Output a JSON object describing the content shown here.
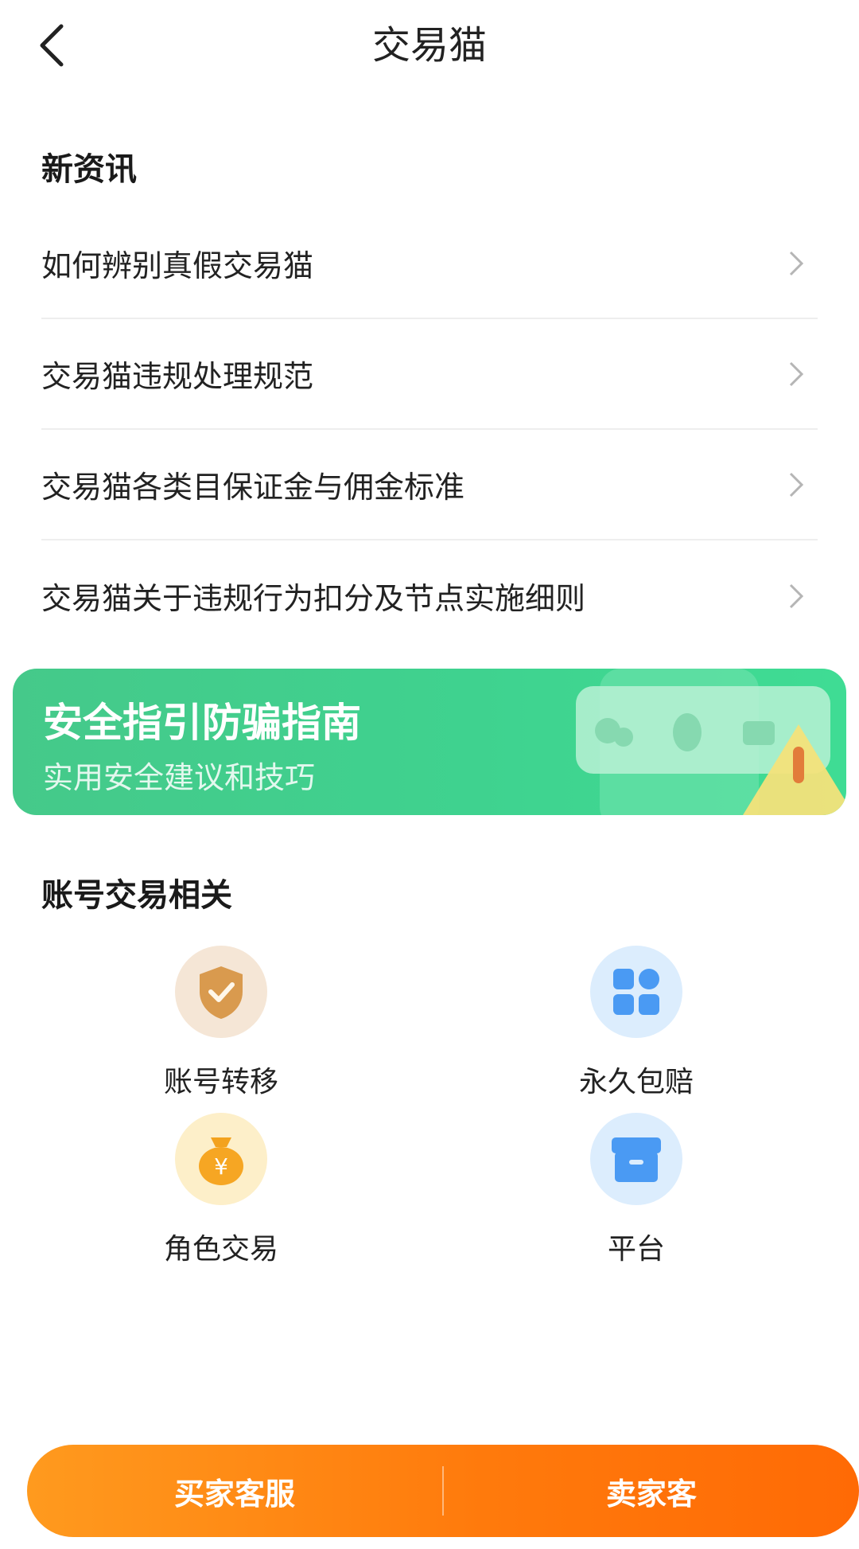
{
  "header": {
    "title": "交易猫",
    "back_icon": "chevron-left-icon"
  },
  "news": {
    "title": "新资讯",
    "items": [
      {
        "label": "如何辨别真假交易猫"
      },
      {
        "label": "交易猫违规处理规范"
      },
      {
        "label": "交易猫各类目保证金与佣金标准"
      },
      {
        "label": "交易猫关于违规行为扣分及节点实施细则"
      }
    ]
  },
  "banner": {
    "title": "安全指引防骗指南",
    "subtitle": "实用安全建议和技巧",
    "color": "#3fd28f"
  },
  "account": {
    "title": "账号交易相关",
    "items": [
      {
        "label": "账号转移",
        "icon": "shield-check-icon"
      },
      {
        "label": "永久包赔",
        "icon": "grid-apps-icon"
      },
      {
        "label": "角色交易",
        "icon": "money-bag-icon"
      },
      {
        "label": "平台",
        "icon": "box-icon"
      }
    ]
  },
  "bottom": {
    "buyer_service": "买家客服",
    "seller_service": "卖家客",
    "accent": "#ff7a0c"
  }
}
